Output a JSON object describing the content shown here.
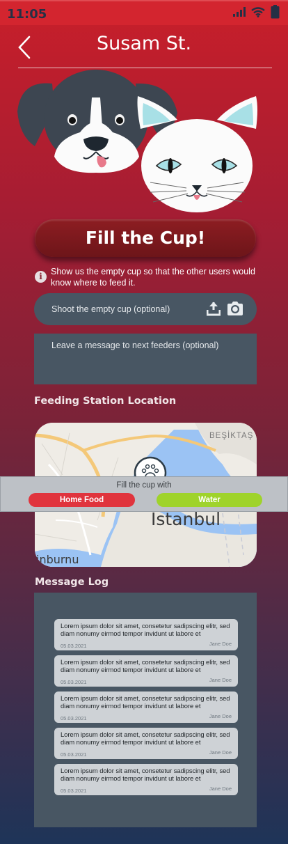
{
  "status_bar": {
    "time": "11:05",
    "icons": [
      "signal-icon",
      "wifi-icon",
      "battery-icon"
    ]
  },
  "header": {
    "title": "Susam St.",
    "back_icon": "chevron-left-icon"
  },
  "illustration": {
    "subjects": [
      "dog-face-icon",
      "cat-face-icon"
    ]
  },
  "fill_button": {
    "label": "Fill the Cup!"
  },
  "info": {
    "icon": "info-icon",
    "text": "Show us the empty cup so that the other users would know where to feed it."
  },
  "shoot": {
    "label": "Shoot the empty cup (optional)",
    "icons": [
      "upload-icon",
      "camera-icon"
    ]
  },
  "message_input": {
    "placeholder": "Leave a message to next feeders (optional)"
  },
  "location": {
    "heading": "Feeding Station Location",
    "map_labels": {
      "city": "Istanbul",
      "district_top": "BEŞİKTAŞ",
      "district_left": "inburnu"
    },
    "marker_icon": "paw-icon"
  },
  "fill_with": {
    "label": "Fill the cup with",
    "options": [
      "Home Food",
      "Water"
    ]
  },
  "message_log": {
    "heading": "Message Log",
    "entries": [
      {
        "text": "Lorem ipsum dolor sit amet, consetetur sadipscing elitr, sed diam nonumy eirmod tempor invidunt ut labore et",
        "date": "05.03.2021",
        "author": "Jane Doe"
      },
      {
        "text": "Lorem ipsum dolor sit amet, consetetur sadipscing elitr, sed diam nonumy eirmod tempor invidunt ut labore et",
        "date": "05.03.2021",
        "author": "Jane Doe"
      },
      {
        "text": "Lorem ipsum dolor sit amet, consetetur sadipscing elitr, sed diam nonumy eirmod tempor invidunt ut labore et",
        "date": "05.03.2021",
        "author": "Jane Doe"
      },
      {
        "text": "Lorem ipsum dolor sit amet, consetetur sadipscing elitr, sed diam nonumy eirmod tempor invidunt ut labore et",
        "date": "05.03.2021",
        "author": "Jane Doe"
      },
      {
        "text": "Lorem ipsum dolor sit amet, consetetur sadipscing elitr, sed diam nonumy eirmod tempor invidunt ut labore et",
        "date": "05.03.2021",
        "author": "Jane Doe"
      }
    ]
  },
  "colors": {
    "brand_red": "#c81f2a",
    "panel": "#485663",
    "home_food": "#e0343d",
    "water": "#9fd32b"
  }
}
